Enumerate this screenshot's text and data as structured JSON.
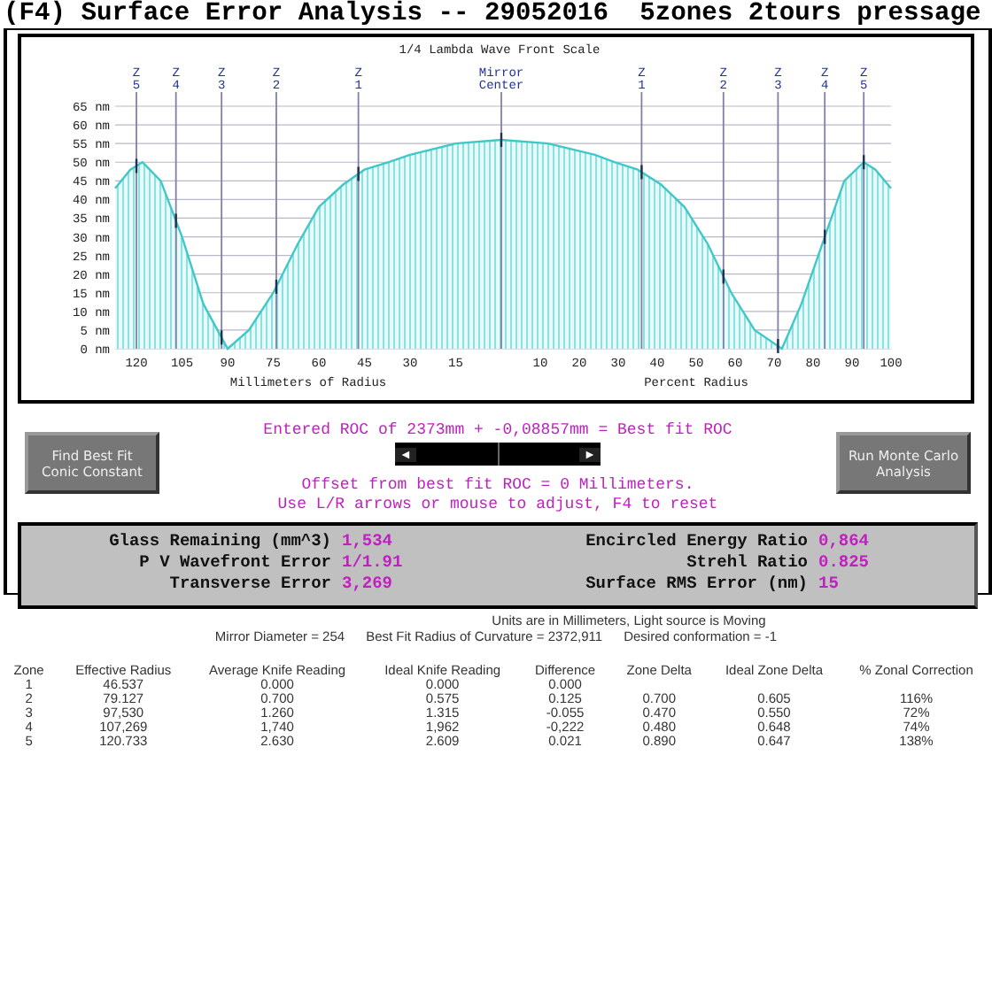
{
  "title": "(F4) Surface Error Analysis -- 29052016  5zones 2tours pressage",
  "charts": [
    {
      "chart_data": {
        "type": "area",
        "title": "1/4 Lambda Wave Front Scale",
        "xlabel": "Millimeters of Radius",
        "grid": true,
        "x": [
          127,
          122,
          118,
          112,
          105,
          98,
          90,
          83,
          75,
          67,
          60,
          52,
          45,
          37,
          30,
          15,
          0
        ],
        "series": [
          {
            "color": "#40c8c8",
            "values": [
              43,
              48,
              50,
              45,
              30,
              12,
              0,
              5,
              15,
              28,
              38,
              44,
              48,
              50,
              52,
              55,
              56
            ]
          }
        ],
        "xlim": [
          127,
          0
        ],
        "ylim": [
          0,
          65
        ],
        "xticks": [
          120,
          105,
          90,
          75,
          60,
          45,
          30,
          15
        ],
        "yticks": [
          {
            "value": 0,
            "label": "0 nm"
          },
          {
            "value": 5,
            "label": "5 nm"
          },
          {
            "value": 10,
            "label": "10 nm"
          },
          {
            "value": 15,
            "label": "15 nm"
          },
          {
            "value": 20,
            "label": "20 nm"
          },
          {
            "value": 25,
            "label": "25 nm"
          },
          {
            "value": 30,
            "label": "30 nm"
          },
          {
            "value": 35,
            "label": "35 nm"
          },
          {
            "value": 40,
            "label": "40 nm"
          },
          {
            "value": 45,
            "label": "45 nm"
          },
          {
            "value": 50,
            "label": "50 nm"
          },
          {
            "value": 55,
            "label": "55 nm"
          },
          {
            "value": 60,
            "label": "60 nm"
          },
          {
            "value": 65,
            "label": "65 nm"
          }
        ],
        "ref_lines": [
          {
            "axis": "x",
            "value": 120,
            "label": "Z 5"
          },
          {
            "axis": "x",
            "value": 107,
            "label": "Z 4"
          },
          {
            "axis": "x",
            "value": 92,
            "label": "Z 3"
          },
          {
            "axis": "x",
            "value": 74,
            "label": "Z 2"
          },
          {
            "axis": "x",
            "value": 47,
            "label": "Z 1"
          }
        ]
      },
      "center_label": "Mirror Center"
    },
    {
      "chart_data": {
        "type": "area",
        "xlabel": "Percent Radius",
        "grid": true,
        "x": [
          0,
          12,
          24,
          29,
          35,
          41,
          47,
          53,
          59,
          65,
          72,
          77,
          83,
          88,
          93,
          96,
          100
        ],
        "series": [
          {
            "color": "#40c8c8",
            "values": [
              56,
              55,
              52,
              50,
              48,
              44,
              38,
              28,
              15,
              5,
              0,
              12,
              30,
              45,
              50,
              48,
              43
            ]
          }
        ],
        "xlim": [
          0,
          100
        ],
        "ylim": [
          0,
          65
        ],
        "xticks": [
          10,
          20,
          30,
          40,
          50,
          60,
          70,
          80,
          90,
          100
        ],
        "ref_lines": [
          {
            "axis": "x",
            "value": 36,
            "label": "Z 1"
          },
          {
            "axis": "x",
            "value": 57,
            "label": "Z 2"
          },
          {
            "axis": "x",
            "value": 71,
            "label": "Z 3"
          },
          {
            "axis": "x",
            "value": 83,
            "label": "Z 4"
          },
          {
            "axis": "x",
            "value": 93,
            "label": "Z 5"
          }
        ]
      }
    }
  ],
  "buttons": [
    {
      "label": "Find Best Fit Conic Constant"
    },
    {
      "label": "Run Monte Carlo Analysis"
    }
  ],
  "roc_line": "Entered ROC of 2373mm + -0,08857mm = Best fit ROC",
  "roc_slider": {
    "left_arrow": "◄",
    "right_arrow": "►",
    "level": 0.5
  },
  "offset_line": "Offset from best fit ROC = 0 Millimeters.",
  "hint_line": "Use L/R arrows or mouse to adjust, F4 to reset",
  "stats_left": [
    {
      "label": "Glass Remaining (mm^3)",
      "value": "1,534"
    },
    {
      "label": "P V Wavefront Error",
      "value": "1/1.91"
    },
    {
      "label": "Transverse Error",
      "value": "3,269"
    }
  ],
  "stats_right": [
    {
      "label": "Encircled Energy Ratio",
      "value": "0,864"
    },
    {
      "label": "Strehl Ratio",
      "value": "0.825"
    },
    {
      "label": "Surface RMS Error (nm)",
      "value": "15"
    }
  ],
  "units_line": "Units are in Millimeters, Light source is Moving",
  "info_line": [
    "Mirror Diameter = 254",
    "Best Fit Radius of Curvature = 2372,911",
    "Desired conformation = -1"
  ],
  "table": {
    "columns": [
      "Zone",
      "Effective Radius",
      "Average Knife Reading",
      "Ideal Knife Reading",
      "Difference",
      "Zone Delta",
      "Ideal Zone Delta",
      "% Zonal Correction"
    ],
    "rows": [
      [
        "1",
        "46.537",
        "0.000",
        "0.000",
        "0.000",
        "",
        "",
        ""
      ],
      [
        "2",
        "79.127",
        "0.700",
        "0.575",
        "0.125",
        "0.700",
        "0.605",
        "116%"
      ],
      [
        "3",
        "97,530",
        "1.260",
        "1.315",
        "-0.055",
        "0.470",
        "0.550",
        "72%"
      ],
      [
        "4",
        "107,269",
        "1,740",
        "1,962",
        "-0,222",
        "0.480",
        "0.648",
        "74%"
      ],
      [
        "5",
        "120.733",
        "2.630",
        "2.609",
        "0.021",
        "0.890",
        "0.647",
        "138%"
      ]
    ]
  }
}
